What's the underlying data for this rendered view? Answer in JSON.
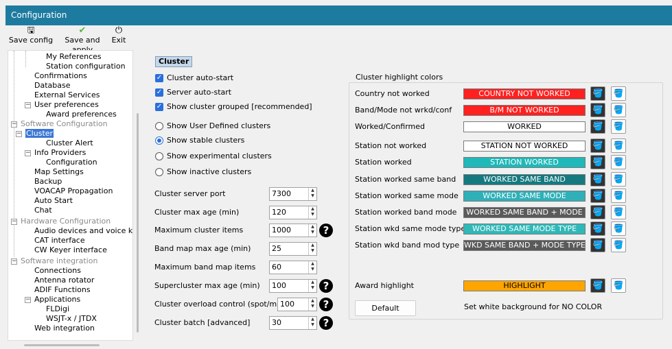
{
  "window": {
    "title": "Configuration"
  },
  "toolbar": {
    "save_config": "Save config",
    "save_apply": "Save and apply",
    "exit": "Exit",
    "icons": [
      "save-icon",
      "check-icon",
      "power-icon"
    ]
  },
  "tree": {
    "items": [
      "My References",
      "Station configuration",
      "Confirmations",
      "Database",
      "External Services",
      "User preferences",
      "Award preferences",
      "Software Configuration",
      "Cluster",
      "Cluster Alert",
      "Info Providers",
      "Configuration",
      "Map Settings",
      "Backup",
      "VOACAP Propagation",
      "Auto Start",
      "Chat",
      "Hardware Configuration",
      "Audio devices and voice keye",
      "CAT interface",
      "CW Keyer interface",
      "Software integration",
      "Connections",
      "Antenna rotator",
      "ADIF Functions",
      "Applications",
      "FLDigi",
      "WSJT-x / JTDX",
      "Web integration"
    ],
    "selected": "Cluster"
  },
  "section": {
    "title": "Cluster"
  },
  "checkboxes": [
    {
      "label": "Cluster auto-start",
      "checked": true
    },
    {
      "label": "Server auto-start",
      "checked": true
    },
    {
      "label": "Show cluster grouped [recommended]",
      "checked": true
    }
  ],
  "radios": [
    {
      "label": "Show User Defined clusters",
      "selected": false
    },
    {
      "label": "Show stable clusters",
      "selected": true
    },
    {
      "label": "Show experimental clusters",
      "selected": false
    },
    {
      "label": "Show inactive clusters",
      "selected": false
    }
  ],
  "fields": [
    {
      "label": "Cluster server port",
      "value": "7300",
      "help": false
    },
    {
      "label": "Cluster max age (min)",
      "value": "120",
      "help": false
    },
    {
      "label": "Maximum cluster items",
      "value": "1000",
      "help": true
    },
    {
      "label": "Band map max age (min)",
      "value": "25",
      "help": false
    },
    {
      "label": "Maximum band map items",
      "value": "60",
      "help": false
    },
    {
      "label": "Supercluster max age (min)",
      "value": "100",
      "help": true
    },
    {
      "label": "Cluster overload control (spot/min)",
      "value": "100",
      "help": true
    },
    {
      "label": "Cluster batch [advanced]",
      "value": "30",
      "help": true
    }
  ],
  "help_mark": "?",
  "highlight": {
    "group_title": "Cluster highlight colors",
    "rows": [
      {
        "label": "Country not worked",
        "text": "COUNTRY NOT WORKED",
        "bg": "#ff2020",
        "fg": "#ffffff"
      },
      {
        "label": "Band/Mode not wrkd/conf",
        "text": "B/M NOT WORKED",
        "bg": "#ff2020",
        "fg": "#ffffff"
      },
      {
        "label": "Worked/Confirmed",
        "text": "WORKED",
        "bg": "#ffffff",
        "fg": "#000000"
      },
      {
        "label": "Station not worked",
        "text": "STATION NOT WORKED",
        "bg": "#ffffff",
        "fg": "#000000"
      },
      {
        "label": "Station worked",
        "text": "STATION WORKED",
        "bg": "#20b8b8",
        "fg": "#ffffff"
      },
      {
        "label": "Station worked same band",
        "text": "WORKED SAME BAND",
        "bg": "#157a80",
        "fg": "#ffffff"
      },
      {
        "label": "Station worked same mode",
        "text": "WORKED SAME MODE",
        "bg": "#2fb0b8",
        "fg": "#ffffff"
      },
      {
        "label": "Station worked band mode",
        "text": "WORKED SAME BAND + MODE",
        "bg": "#5a5a5a",
        "fg": "#ffffff"
      },
      {
        "label": "Station wkd same mode type",
        "text": "WORKED SAME MODE TYPE",
        "bg": "#2fb8b8",
        "fg": "#ffffff"
      },
      {
        "label": "Station wkd band mod type",
        "text": "WKD SAME BAND + MODE TYPE",
        "bg": "#5a5a5a",
        "fg": "#ffffff"
      }
    ],
    "award": {
      "label": "Award highlight",
      "text": "HIGHLIGHT",
      "bg": "#ffa500",
      "fg": "#000000"
    },
    "default_button": "Default",
    "note": "Set white background for NO COLOR"
  }
}
